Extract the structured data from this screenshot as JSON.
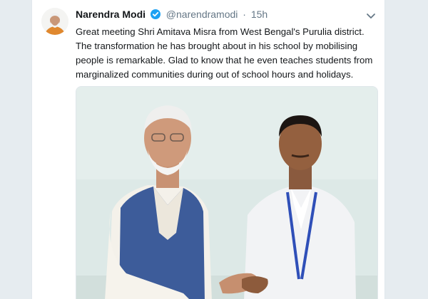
{
  "tweet": {
    "author_name": "Narendra Modi",
    "handle": "@narendramodi",
    "separator": "·",
    "time": "15h",
    "text": "Great meeting Shri Amitava Misra from West Bengal's Purulia district. The transformation he has brought about in his school by mobilising people is remarkable. Glad to know that he even teaches students from marginalized communities during out of school hours and holidays."
  },
  "colors": {
    "page_background": "#e6ecf0",
    "card_background": "#ffffff",
    "name_text": "#14171a",
    "secondary_text": "#657786",
    "verified_badge": "#1da1f2",
    "photo_backdrop": "#dde9e7",
    "vest": "#3d5c9a",
    "lanyard": "#2f4fb8"
  },
  "icons": {
    "verified": "verified-badge-icon",
    "menu": "chevron-down-icon"
  }
}
